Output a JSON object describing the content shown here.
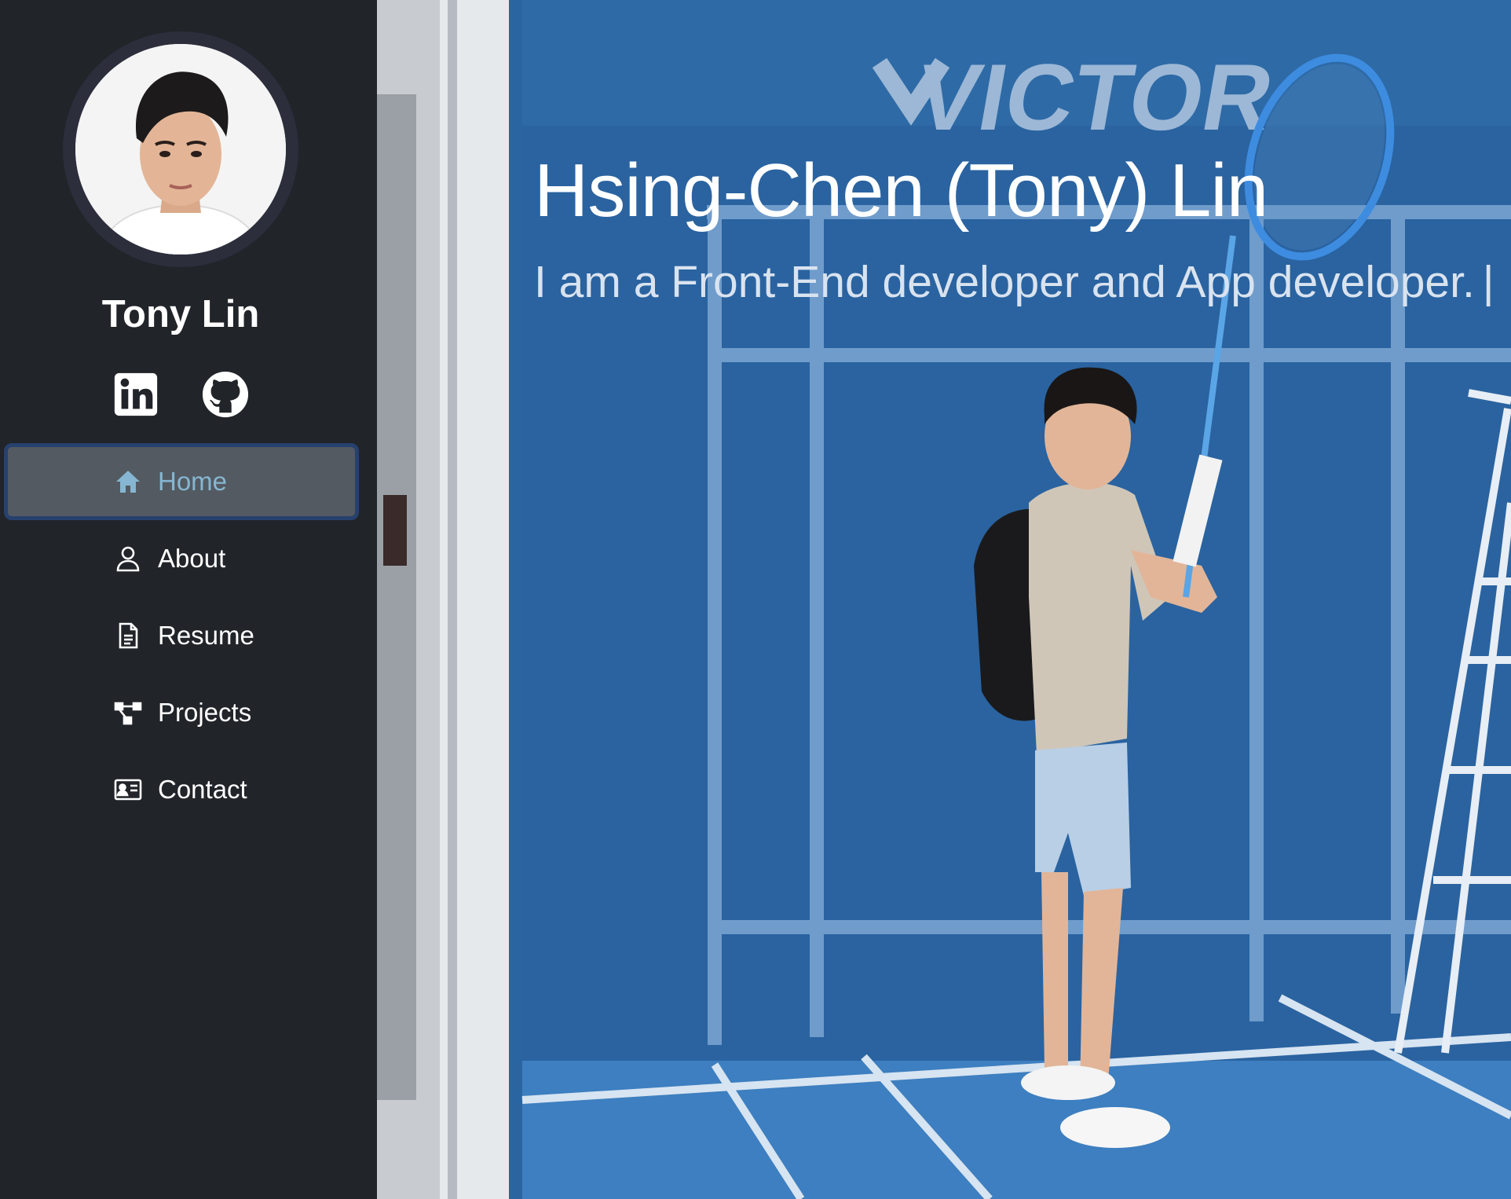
{
  "profile": {
    "name": "Tony Lin"
  },
  "socials": [
    {
      "icon": "linkedin-icon"
    },
    {
      "icon": "github-icon"
    }
  ],
  "nav": {
    "items": [
      {
        "label": "Home",
        "icon": "home-icon",
        "active": true
      },
      {
        "label": "About",
        "icon": "user-icon",
        "active": false
      },
      {
        "label": "Resume",
        "icon": "document-icon",
        "active": false
      },
      {
        "label": "Projects",
        "icon": "diagram-icon",
        "active": false
      },
      {
        "label": "Contact",
        "icon": "contact-card-icon",
        "active": false
      }
    ]
  },
  "hero": {
    "title": "Hsing-Chen (Tony) Lin",
    "subtitle": "I am a Front-End developer and App developer.",
    "cursor": "|",
    "banner_text": "VICTOR"
  },
  "colors": {
    "sidebar_bg": "#212429",
    "active_item_bg": "#545a61",
    "active_item_border": "#27416e",
    "active_item_text": "#86b6d1",
    "hero_bg": "#2a64a1"
  }
}
